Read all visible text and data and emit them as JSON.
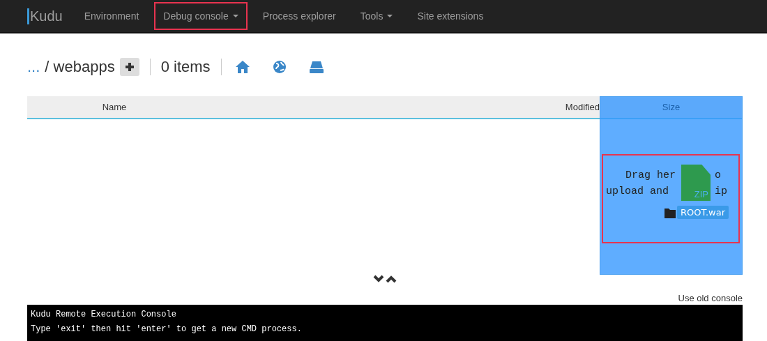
{
  "navbar": {
    "brand": "Kudu",
    "items": [
      {
        "label": "Environment",
        "dropdown": false,
        "highlighted": false
      },
      {
        "label": "Debug console",
        "dropdown": true,
        "highlighted": true
      },
      {
        "label": "Process explorer",
        "dropdown": false,
        "highlighted": false
      },
      {
        "label": "Tools",
        "dropdown": true,
        "highlighted": false
      },
      {
        "label": "Site extensions",
        "dropdown": false,
        "highlighted": false
      }
    ]
  },
  "breadcrumb": {
    "ellipsis": "...",
    "folder": "/ webapps",
    "count": "0 items"
  },
  "table": {
    "columns": [
      "Name",
      "Modified",
      "Size"
    ]
  },
  "drop_zone": {
    "highlighted": true,
    "hint_lines": [
      [
        "Drag her",
        "o"
      ],
      [
        "upload and",
        "ip"
      ]
    ],
    "file_badge": "ZIP",
    "file_name": "ROOT.war"
  },
  "old_console_link": "Use old console",
  "console": {
    "lines": [
      "Kudu Remote Execution Console",
      "Type 'exit' then hit 'enter' to get a new CMD process."
    ]
  }
}
